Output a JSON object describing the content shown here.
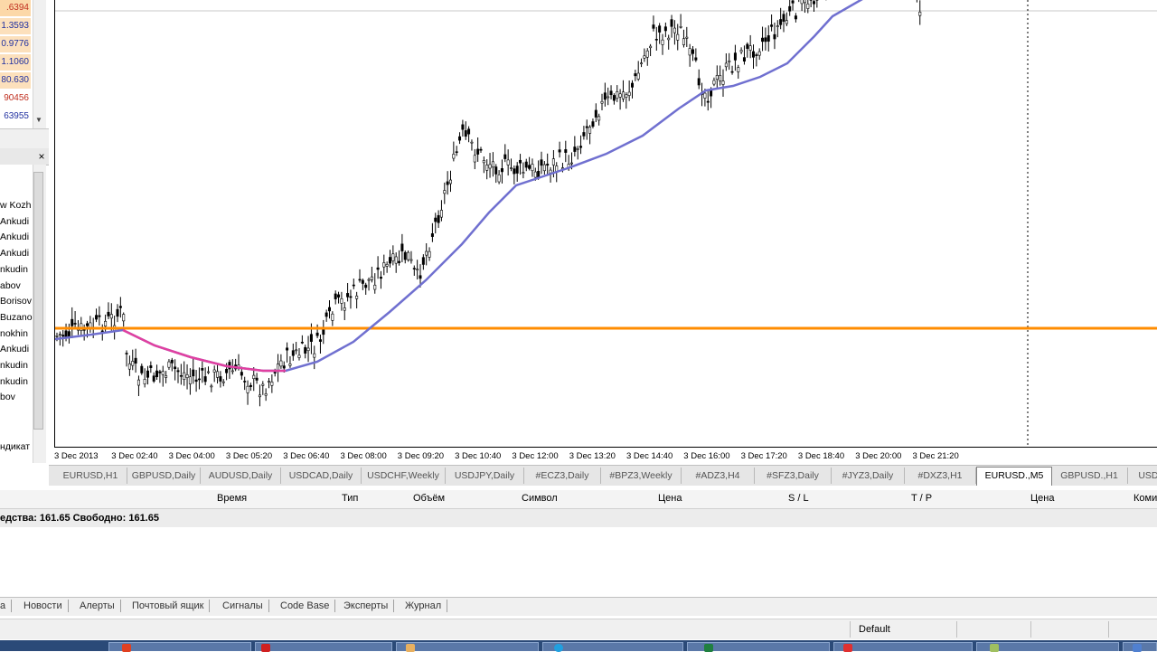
{
  "market_watch": {
    "rows": [
      {
        "text": ".6394",
        "bg": "#fcd8a8",
        "color": "#c03020"
      },
      {
        "text": "1.3593",
        "bg": "#fce0bc",
        "color": "#2030a0"
      },
      {
        "text": "0.9776",
        "bg": "#fce0bc",
        "color": "#2030a0"
      },
      {
        "text": "1.1060",
        "bg": "#fce0bc",
        "color": "#2030a0"
      },
      {
        "text": "80.630",
        "bg": "#fce0bc",
        "color": "#2030a0"
      },
      {
        "text": "90456",
        "bg": "#fff",
        "color": "#c03020"
      },
      {
        "text": "63955",
        "bg": "#fff",
        "color": "#2030a0"
      }
    ]
  },
  "navigator": {
    "close_label": "×",
    "items": [
      "w Kozh",
      "Ankudi",
      "Ankudi",
      "Ankudi",
      "nkudin",
      "abov",
      "Borisov",
      "Buzano",
      "nokhin",
      "Ankudi",
      "nkudin",
      "nkudin",
      "bov"
    ],
    "footer": "ндикат"
  },
  "chart": {
    "symbol": "EURUSD., M5",
    "horizontal_line_color": "#ff8c00",
    "ma_color": "#7070d0",
    "ma_highlight_color": "#e040a0",
    "time_labels": [
      "3 Dec 2013",
      "3 Dec 02:40",
      "3 Dec 04:00",
      "3 Dec 05:20",
      "3 Dec 06:40",
      "3 Dec 08:00",
      "3 Dec 09:20",
      "3 Dec 10:40",
      "3 Dec 12:00",
      "3 Dec 13:20",
      "3 Dec 14:40",
      "3 Dec 16:00",
      "3 Dec 17:20",
      "3 Dec 18:40",
      "3 Dec 20:00",
      "3 Dec 21:20"
    ]
  },
  "chart_tabs": {
    "items": [
      "EURUSD,H1",
      "GBPUSD,Daily",
      "AUDUSD,Daily",
      "USDCAD,Daily",
      "USDCHF,Weekly",
      "USDJPY,Daily",
      "#ECZ3,Daily",
      "#BPZ3,Weekly",
      "#ADZ3,H4",
      "#SFZ3,Daily",
      "#JYZ3,Daily",
      "#DXZ3,H1",
      "EURUSD.,M5",
      "GBPUSD.,H1",
      "USDCH"
    ],
    "active_index": 12
  },
  "terminal": {
    "columns": [
      "Время",
      "Тип",
      "Объём",
      "Символ",
      "Цена",
      "S / L",
      "T / P",
      "Цена",
      "Коми"
    ],
    "balance_text": "едства: 161.65  Свободно: 161.65",
    "tabs": [
      "а",
      "Новости",
      "Алерты",
      "Почтовый ящик",
      "Сигналы",
      "Code Base",
      "Эксперты",
      "Журнал"
    ]
  },
  "status_bar": {
    "profile": "Default"
  }
}
